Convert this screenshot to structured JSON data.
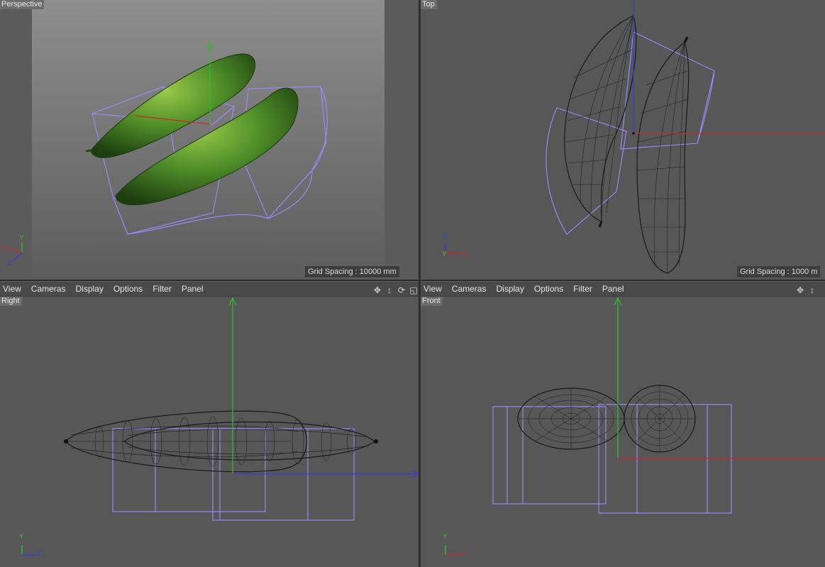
{
  "viewports": {
    "perspective": {
      "label": "Perspective",
      "grid_spacing": "Grid Spacing : 10000 mm"
    },
    "top": {
      "label": "Top",
      "grid_spacing": "Grid Spacing : 1000 m"
    },
    "right": {
      "label": "Right"
    },
    "front": {
      "label": "Front"
    }
  },
  "menus": {
    "left": [
      "View",
      "Cameras",
      "Display",
      "Options",
      "Filter",
      "Panel"
    ],
    "right": [
      "View",
      "Cameras",
      "Display",
      "Options",
      "Filter",
      "Panel"
    ]
  },
  "nav_icons": [
    "move-view-icon",
    "zoom-view-icon",
    "rotate-view-icon",
    "toggle-layout-icon"
  ],
  "axes": {
    "perspective": [
      "Y",
      "X",
      "Z"
    ],
    "top": [
      "Z",
      "Y",
      "X"
    ],
    "right": [
      "Y",
      "Z"
    ],
    "front": [
      "Y",
      "X"
    ]
  },
  "colors": {
    "axis_x": "#cc2a2a",
    "axis_y": "#2fbf2f",
    "axis_z": "#3a3adc",
    "bounding_box": "#9b8cff",
    "wireframe": "#1a1a1a",
    "cucumber_green": "#3f7a22"
  }
}
